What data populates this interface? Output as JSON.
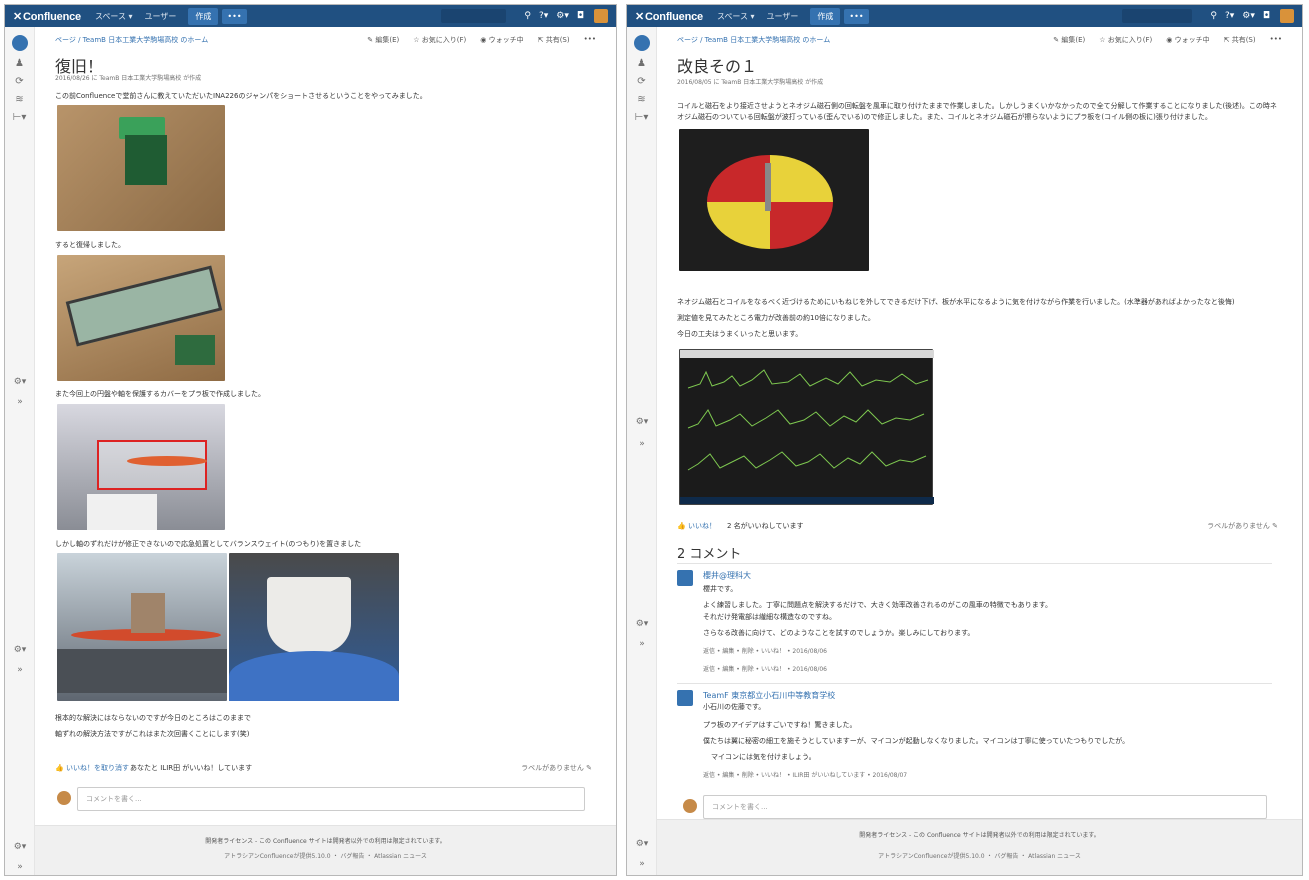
{
  "app": {
    "logo": "Confluence",
    "nav_spaces": "スペース ▾",
    "nav_users": "ユーザー",
    "create": "作成",
    "more": "•••"
  },
  "left": {
    "breadcrumb": "ページ / TeamB 日本工業大学駒場高校 のホーム",
    "actions": {
      "edit": "✎ 編集(E)",
      "fav": "☆ お気に入り(F)",
      "watch": "◉ ウォッチ中",
      "share": "⇱ 共有(S)",
      "more": "•••"
    },
    "title": "復旧！",
    "meta": "2016/08/26 に TeamB 日本工業大学駒場高校 が作成",
    "p1": "この前Confluenceで堂前さんに教えていただいたINA226のジャンパをショートさせるということをやってみました。",
    "p2": "すると復帰しました。",
    "p3": "また今回上の円盤や軸を保護するカバーをプラ板で作成しました。",
    "p4": "しかし軸のずれだけが修正できないので応急処置としてバランスウェイト(のつもり)を置きました",
    "p5": "根本的な解決にはならないのですが今日のところはこのままで",
    "p6": "軸ずれの解決方法ですがこれはまた次回書くことにします(笑)",
    "likes_action": "👍 いいね！を取り消す",
    "likes_text": "あなたと ILIR田 がいいね！しています",
    "labels": "ラベルがありません ✎",
    "comment_placeholder": "コメントを書く...",
    "footer1": "開発者ライセンス - この Confluence サイトは開発者以外での利用は限定されています。",
    "footer2": "アトラシアンConfluenceが提供5.10.0 ・ バグ報告 ・ Atlassian ニュース"
  },
  "right": {
    "breadcrumb": "ページ / TeamB 日本工業大学駒場高校 のホーム",
    "actions": {
      "edit": "✎ 編集(E)",
      "fav": "☆ お気に入り(F)",
      "watch": "◉ ウォッチ中",
      "share": "⇱ 共有(S)",
      "more": "•••"
    },
    "title": "改良その１",
    "meta": "2016/08/05 に TeamB 日本工業大学駒場高校 が作成",
    "p1": "コイルと磁石をより接近させようとネオジム磁石側の回転盤を風車に取り付けたままで作業しました。しかしうまくいかなかったので全て分解して作業することになりました(後述)。この時ネオジム磁石のついている回転盤が波打っている(歪んでいる)ので修正しました。また、コイルとネオジム磁石が擦らないようにプラ板を(コイル側の板に)張り付けました。",
    "p2": "ネオジム磁石とコイルをなるべく近づけるためにいもねじを外してできるだけ下げ、板が水平になるように気を付けながら作業を行いました。(水準器があればよかったなと後悔)",
    "p3": "測定値を見てみたところ電力が改善前の約10倍になりました。",
    "p4": "今日の工夫はうまくいったと思います。",
    "likes_action": "👍 いいね！",
    "likes_text": "2 名がいいねしています",
    "labels": "ラベルがありません ✎",
    "comments_title": "2 コメント",
    "c1_name": "櫻井@理科大",
    "c1_l1": "櫻井です。",
    "c1_l2": "よく練習しました。丁寧に問題点を解決するだけで、大きく効率改善されるのがこの風車の特徴でもあります。",
    "c1_l3": "それだけ発電部は繊細な構造なのですね。",
    "c1_l4": "さらなる改善に向けて、どのようなことを試すのでしょうか。楽しみにしております。",
    "c1_foot": "返信 • 編集 • 削除 • いいね！ • 2016/08/06",
    "c1_foot2": "返信 • 編集 • 削除 • いいね！ • 2016/08/06",
    "c2_name": "TeamF 東京都立小石川中等教育学校",
    "c2_l1": "小石川の佐藤です。",
    "c2_l2": "プラ板のアイデアはすごいですね！驚きました。",
    "c2_l3": "僕たちは翼に秘密の細工を施そうとしていますーが、マイコンが起動しなくなりました。マイコンは丁寧に使っていたつもりでしたが。",
    "c2_l4": "マイコンには気を付けましょう。",
    "c2_foot": "返信 • 編集 • 削除 • いいね！ • ILIR田 がいいねしています • 2016/08/07",
    "comment_placeholder": "コメントを書く...",
    "footer1": "開発者ライセンス - この Confluence サイトは開発者以外での利用は限定されています。",
    "footer2": "アトラシアンConfluenceが提供5.10.0 ・ バグ報告 ・ Atlassian ニュース"
  }
}
